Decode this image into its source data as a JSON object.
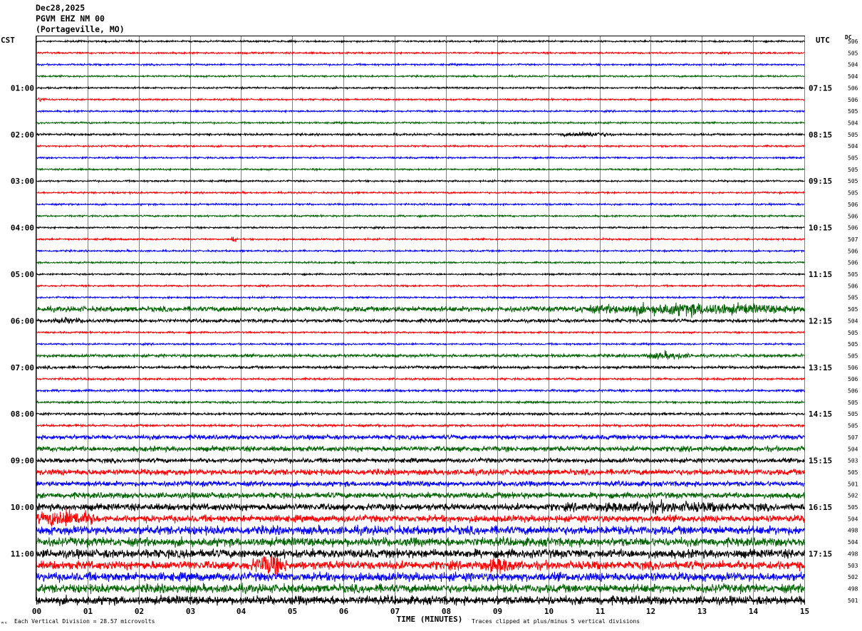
{
  "header": {
    "date": "Dec28,2025",
    "station": "PGVM EHZ NM 00",
    "location": "(Portageville, MO)"
  },
  "left_tz": "CST",
  "right_tz": "UTC",
  "dc_label": "DC",
  "footer": {
    "xlabel": "TIME (MINUTES)",
    "scale_note": "Each Vertical Division =   28.57 microvolts",
    "clip_note": "Traces clipped at plus/minus 5 vertical divisions",
    "logo": "ʷᵉ"
  },
  "colors": {
    "black": "#000000",
    "red": "#ff0000",
    "blue": "#0000ff",
    "green": "#006400",
    "grid": "#808080"
  },
  "chart_data": {
    "type": "line",
    "title": "PGVM EHZ NM 00 (Portageville, MO) Dec28,2025",
    "xlabel": "TIME (MINUTES)",
    "xlim": [
      0,
      15
    ],
    "x_ticks": [
      "00",
      "01",
      "02",
      "03",
      "04",
      "05",
      "06",
      "07",
      "08",
      "09",
      "10",
      "11",
      "12",
      "13",
      "14",
      "15"
    ],
    "cst_hour_labels": [
      "01:00",
      "02:00",
      "03:00",
      "04:00",
      "05:00",
      "06:00",
      "07:00",
      "08:00",
      "09:00",
      "10:00",
      "11:00"
    ],
    "utc_hour_labels": [
      "07:15",
      "08:15",
      "09:15",
      "10:15",
      "11:15",
      "12:15",
      "13:15",
      "14:15",
      "15:15",
      "16:15",
      "17:15"
    ],
    "color_cycle": [
      "black",
      "red",
      "blue",
      "green"
    ],
    "dc_offsets": [
      506,
      505,
      504,
      504,
      506,
      506,
      505,
      504,
      505,
      504,
      505,
      505,
      505,
      505,
      506,
      506,
      506,
      507,
      506,
      506,
      505,
      506,
      505,
      505,
      504,
      505,
      505,
      505,
      506,
      506,
      506,
      505,
      505,
      505,
      507,
      504,
      503,
      505,
      501,
      502,
      505,
      504,
      498,
      504,
      498,
      503,
      502,
      498,
      501
    ],
    "trace_amplitude_divisions": [
      1,
      1,
      1,
      1,
      1,
      1,
      1,
      1,
      1.2,
      1,
      1,
      1,
      1,
      1,
      1,
      1,
      1,
      1,
      1,
      1,
      1,
      1,
      1,
      3,
      2,
      1,
      1,
      1.8,
      1.6,
      1.2,
      1.3,
      1.2,
      1.4,
      1.4,
      2.6,
      3,
      2.6,
      3.4,
      3,
      3.4,
      4,
      4,
      5,
      5,
      5,
      5,
      5,
      5,
      5
    ],
    "events": [
      {
        "trace": 5,
        "start_min": 0,
        "end_min": 0.2,
        "amp": 3
      },
      {
        "trace": 8,
        "start_min": 10.2,
        "end_min": 11.3,
        "amp": 3.5
      },
      {
        "trace": 17,
        "start_min": 3.8,
        "end_min": 3.9,
        "amp": 6
      },
      {
        "trace": 23,
        "start_min": 10.5,
        "end_min": 15,
        "amp": 8
      },
      {
        "trace": 24,
        "start_min": 0,
        "end_min": 1.1,
        "amp": 4
      },
      {
        "trace": 27,
        "start_min": 11.8,
        "end_min": 12.8,
        "amp": 5
      },
      {
        "trace": 41,
        "start_min": 0,
        "end_min": 1.2,
        "amp": 12
      },
      {
        "trace": 40,
        "start_min": 9.5,
        "end_min": 15,
        "amp": 7
      },
      {
        "trace": 45,
        "start_min": 4.2,
        "end_min": 4.9,
        "amp": 14
      },
      {
        "trace": 45,
        "start_min": 8.6,
        "end_min": 9.5,
        "amp": 10
      }
    ],
    "grid": true
  }
}
